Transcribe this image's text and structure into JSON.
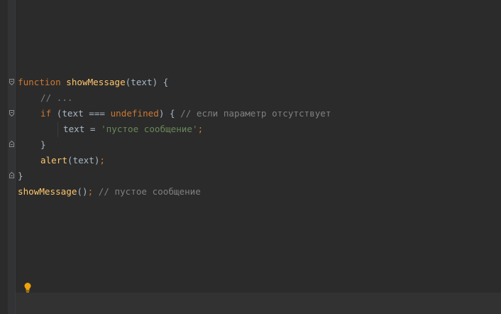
{
  "code": {
    "line1": {
      "kw": "function",
      "fn": "showMessage",
      "rest": "(text) {"
    },
    "line2": {
      "comment": "// ..."
    },
    "line3": {
      "kw": "if",
      "mid1": " (text === ",
      "kw2": "undefined",
      "mid2": ") { ",
      "comment": "// если параметр отсутствует"
    },
    "line4": {
      "pre": "text = ",
      "str": "'пустое сообщение'",
      "semi": ";"
    },
    "line5": {
      "text": "}"
    },
    "line6": {
      "fn": "alert",
      "rest": "(text)",
      "semi": ";"
    },
    "line7": {
      "text": "}"
    },
    "line8": {
      "fn": "showMessage",
      "rest": "()",
      "semi": ";",
      "comment": " // пустое сообщение"
    }
  },
  "icons": {
    "bulb": "lightbulb-icon",
    "fold": "fold-marker-icon"
  },
  "colors": {
    "background": "#2b2b2b",
    "keyword": "#cc7832",
    "function": "#ffc66d",
    "string": "#6a8759",
    "comment": "#808080",
    "text": "#a9b7c6",
    "bulb": "#f0a30a"
  }
}
